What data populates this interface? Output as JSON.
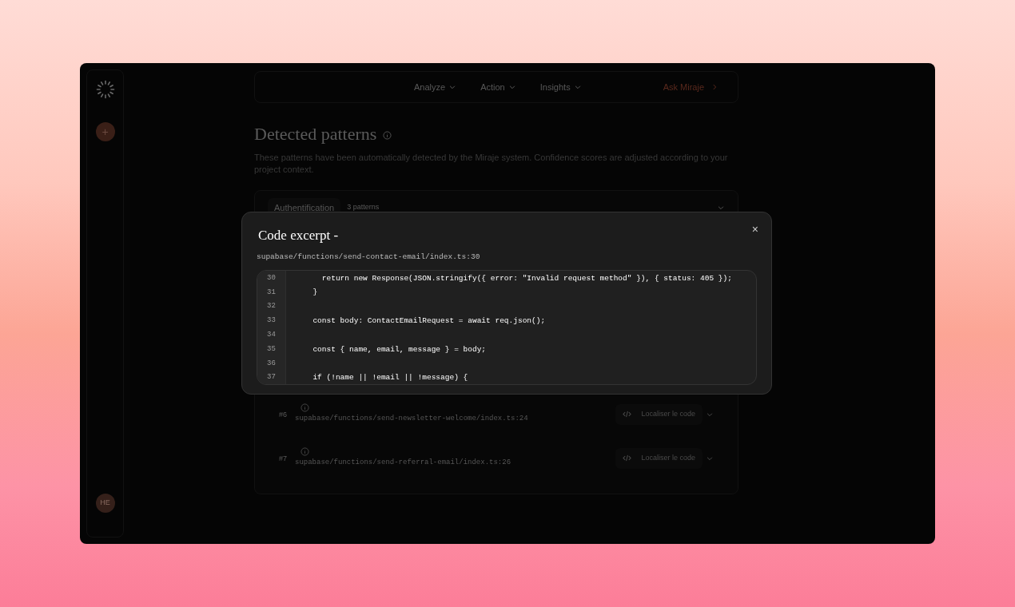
{
  "sidebar": {
    "add_label": "+",
    "avatar_initials": "HE"
  },
  "nav": {
    "items": [
      {
        "label": "Analyze"
      },
      {
        "label": "Action"
      },
      {
        "label": "Insights"
      }
    ],
    "cta": "Ask Miraje"
  },
  "heading": "Detected patterns",
  "description": "These patterns have been automatically detected by the Miraje system. Confidence scores are adjusted according to your project context.",
  "group": {
    "label": "Authentification",
    "count": "3 patterns",
    "expanded": true
  },
  "rows": [
    {
      "number": "#6",
      "path": "supabase/functions/send-newsletter-welcome/index.ts:24",
      "button": "Localiser le code"
    },
    {
      "number": "#7",
      "path": "supabase/functions/send-referral-email/index.ts:26",
      "button": "Localiser le code"
    }
  ],
  "modal": {
    "title": "Code excerpt -",
    "path": "supabase/functions/send-contact-email/index.ts:30",
    "close": "×",
    "lines": [
      {
        "number": "30",
        "code": "    return new Response(JSON.stringify({ error: \"Invalid request method\" }), { status: 405 });"
      },
      {
        "number": "31",
        "code": "  }"
      },
      {
        "number": "32"
      },
      {
        "number": "33",
        "code": "  const body: ContactEmailRequest = await req.json();"
      },
      {
        "number": "34"
      },
      {
        "number": "35",
        "code": "  const { name, email, message } = body;"
      },
      {
        "number": "36"
      },
      {
        "number": "37",
        "code": "  if (!name || !email || !message) {"
      }
    ]
  }
}
